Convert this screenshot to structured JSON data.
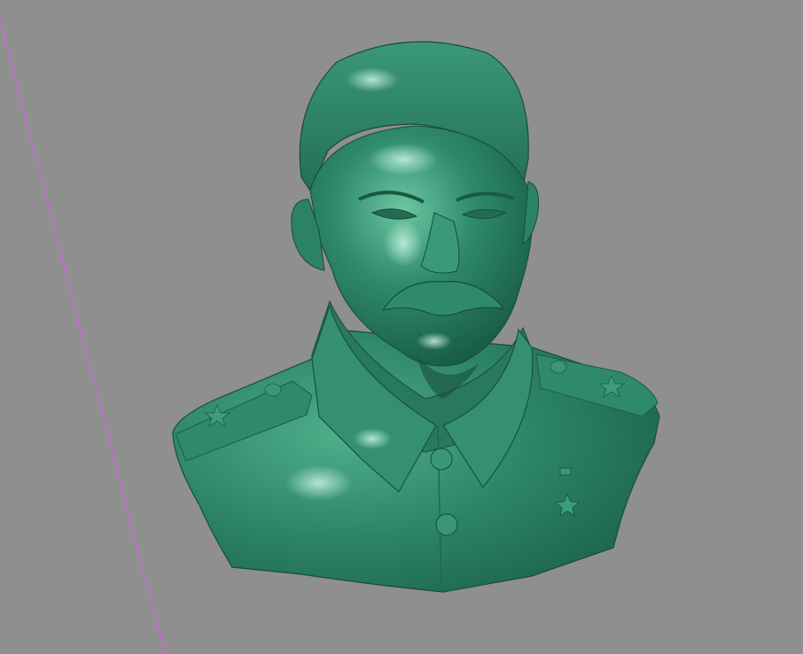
{
  "viewport": {
    "background_color": "#8f8f8f",
    "axis_color": "#c86ad8",
    "model": {
      "name": "bust-model",
      "material_color": "#2f8a6a",
      "highlight_color": "#7fd0b0",
      "shadow_color": "#16503c"
    }
  }
}
